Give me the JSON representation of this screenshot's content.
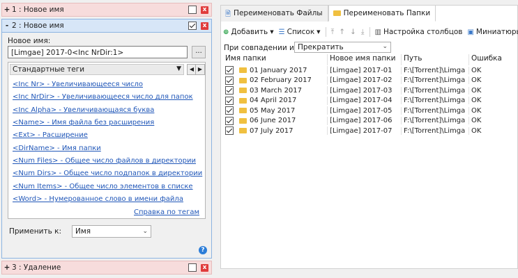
{
  "rules": {
    "rule1": {
      "expander": "+",
      "title": "1 : Новое имя"
    },
    "rule2": {
      "expander": "-",
      "title": "2 : Новое имя"
    },
    "rule3": {
      "expander": "+",
      "title": "3 : Удаление"
    }
  },
  "close_glyph": "x",
  "panel": {
    "new_name_label": "Новое имя:",
    "new_name_value": "[Limgae] 2017-0<Inc NrDir:1>",
    "browse_label": "...",
    "tag_set": "Стандартные теги",
    "tags": [
      "<Inc Nr> - Увеличивающееся число",
      "<Inc NrDir> - Увеличивающееся число для папок",
      "<Inc Alpha> - Увеличивающаяся буква",
      "<Name> - Имя файла без расширения",
      "<Ext> - Расширение",
      "<DirName> - Имя папки",
      "<Num Files> - Общее число файлов в директории",
      "<Num Dirs> - Общее число подпапок в директории",
      "<Num Items> - Общее число элементов в списке",
      "<Word> - Нумерованное слово в имени файла"
    ],
    "help_link": "Справка по тегам",
    "apply_label": "Применить к:",
    "apply_value": "Имя"
  },
  "tabs": {
    "files": "Переименовать Файлы",
    "folders": "Переименовать Папки"
  },
  "toolbar": {
    "add": "Добавить",
    "list": "Список",
    "columns": "Настройка столбцов",
    "thumbs": "Миниатюры"
  },
  "match": {
    "label": "При совпадении имен:",
    "value": "Прекратить"
  },
  "grid": {
    "headers": {
      "folder": "Имя папки",
      "new": "Новое имя папки",
      "path": "Путь",
      "error": "Ошибка"
    },
    "rows": [
      {
        "folder": "01 January 2017",
        "new": "[Limgae] 2017-01",
        "path": "F:\\[Torrent]\\Limga",
        "error": "OK"
      },
      {
        "folder": "02 February 2017",
        "new": "[Limgae] 2017-02",
        "path": "F:\\[Torrent]\\Limga",
        "error": "OK"
      },
      {
        "folder": "03 March 2017",
        "new": "[Limgae] 2017-03",
        "path": "F:\\[Torrent]\\Limga",
        "error": "OK"
      },
      {
        "folder": "04 April 2017",
        "new": "[Limgae] 2017-04",
        "path": "F:\\[Torrent]\\Limga",
        "error": "OK"
      },
      {
        "folder": "05 May 2017",
        "new": "[Limgae] 2017-05",
        "path": "F:\\[Torrent]\\Limga",
        "error": "OK"
      },
      {
        "folder": "06 June 2017",
        "new": "[Limgae] 2017-06",
        "path": "F:\\[Torrent]\\Limga",
        "error": "OK"
      },
      {
        "folder": "07 July 2017",
        "new": "[Limgae] 2017-07",
        "path": "F:\\[Torrent]\\Limga",
        "error": "OK"
      }
    ]
  },
  "colors": {
    "accent": "#2b7dd8",
    "link": "#1f56b8",
    "close": "#e03c3c",
    "active_rule": "#d7e6f7",
    "collapsed_rule": "#f7dcdc"
  }
}
